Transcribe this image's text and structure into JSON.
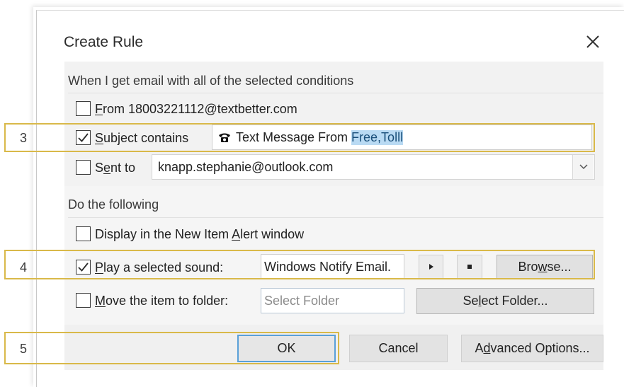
{
  "dialog": {
    "title": "Create Rule",
    "close_icon": "close-icon"
  },
  "conditions": {
    "heading": "When I get email with all of the selected conditions",
    "from": {
      "checked": false,
      "label_accel": "F",
      "label_rest": "rom 18003221112@textbetter.com"
    },
    "subject": {
      "checked": true,
      "label_accel": "S",
      "label_rest": "ubject contains",
      "value_prefix_icon": "phone-icon",
      "value_plain": "Text Message From ",
      "value_selected": "Free,Tolll"
    },
    "sent_to": {
      "checked": false,
      "label_pre": "S",
      "label_accel": "e",
      "label_rest": "nt to",
      "value": "knapp.stephanie@outlook.com"
    }
  },
  "actions": {
    "heading": "Do the following",
    "display_alert": {
      "checked": false,
      "label_pre": "Display in the New Item ",
      "label_accel": "A",
      "label_rest": "lert window"
    },
    "play_sound": {
      "checked": true,
      "label_accel": "P",
      "label_rest": "lay a selected sound:",
      "value": "Windows Notify Email.",
      "play_icon": "play-icon",
      "stop_icon": "stop-icon",
      "browse_pre": "Bro",
      "browse_accel": "w",
      "browse_rest": "se..."
    },
    "move_folder": {
      "checked": false,
      "label_accel": "M",
      "label_rest": "ove the item to folder:",
      "placeholder": "Select Folder",
      "select_pre": "Se",
      "select_accel": "l",
      "select_rest": "ect Folder..."
    }
  },
  "footer": {
    "ok_label": "OK",
    "cancel_label": "Cancel",
    "advanced_pre": "A",
    "advanced_accel": "d",
    "advanced_rest": "vanced Options..."
  },
  "callouts": [
    {
      "number": "3"
    },
    {
      "number": "4"
    },
    {
      "number": "5"
    }
  ],
  "colors": {
    "callout_border": "#d9b949",
    "selection_highlight": "#b9daf3",
    "ok_focus_border": "#5aa0d8"
  }
}
